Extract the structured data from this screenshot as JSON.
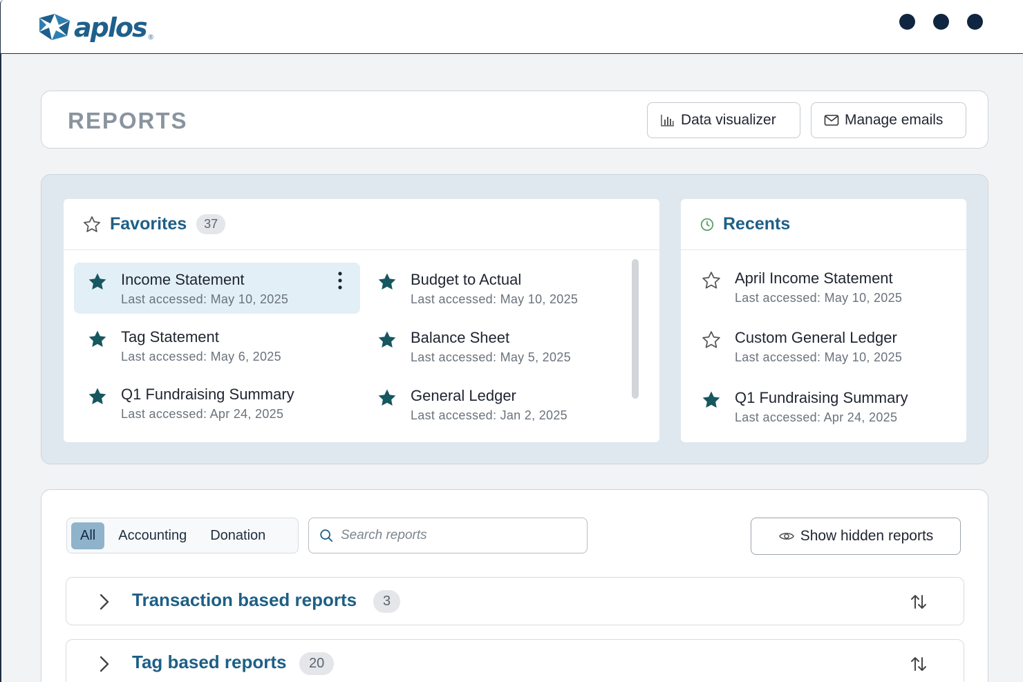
{
  "app": {
    "logo_text": "aplos",
    "logo_reg": "®"
  },
  "header": {
    "title": "REPORTS",
    "data_visualizer_label": "Data visualizer",
    "manage_emails_label": "Manage emails"
  },
  "favorites": {
    "title": "Favorites",
    "count": "37",
    "items": [
      {
        "name": "Income Statement",
        "sub": "Last accessed: May 10, 2025",
        "starred": true
      },
      {
        "name": "Budget to Actual",
        "sub": "Last accessed: May 10, 2025",
        "starred": true
      },
      {
        "name": "Tag Statement",
        "sub": "Last accessed: May 6, 2025",
        "starred": true
      },
      {
        "name": "Balance Sheet",
        "sub": "Last accessed: May 5, 2025",
        "starred": true
      },
      {
        "name": "Q1 Fundraising Summary",
        "sub": "Last accessed: Apr 24, 2025",
        "starred": true
      },
      {
        "name": "General Ledger",
        "sub": "Last accessed: Jan 2, 2025",
        "starred": true
      }
    ]
  },
  "recents": {
    "title": "Recents",
    "items": [
      {
        "name": "April Income Statement",
        "sub": "Last accessed: May 10, 2025",
        "starred": false
      },
      {
        "name": "Custom General Ledger",
        "sub": "Last accessed: May 10, 2025",
        "starred": false
      },
      {
        "name": "Q1 Fundraising Summary",
        "sub": "Last accessed: Apr 24, 2025",
        "starred": true
      }
    ]
  },
  "filters": {
    "tabs": [
      "All",
      "Accounting",
      "Donation"
    ],
    "active_tab": "All",
    "search_placeholder": "Search reports",
    "show_hidden_label": "Show hidden reports"
  },
  "report_groups": [
    {
      "title": "Transaction based reports",
      "count": "3"
    },
    {
      "title": "Tag based reports",
      "count": "20"
    }
  ],
  "colors": {
    "brand": "#1d5f86",
    "star_filled": "#17575f",
    "panel_bg": "#dfe8ee",
    "active_item_bg": "#e2eff6",
    "nav_dots": "#0f2540"
  }
}
